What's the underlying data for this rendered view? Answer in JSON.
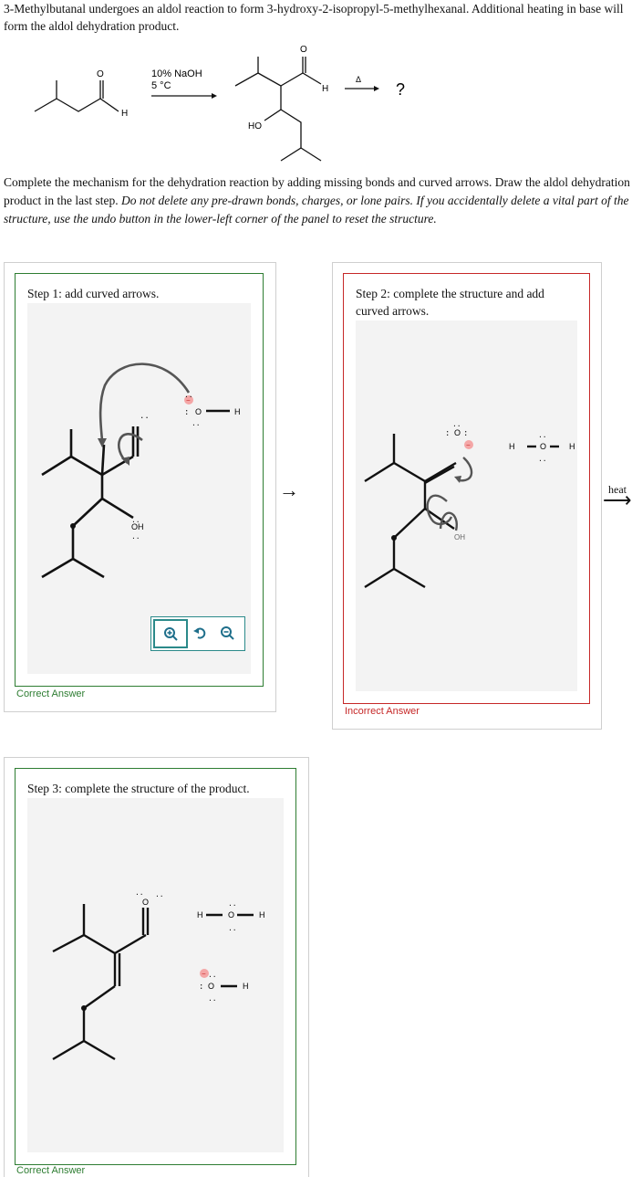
{
  "intro": "3-Methylbutanal undergoes an aldol reaction to form 3-hydroxy-2-isopropyl-5-methylhexanal. Additional heating in base will form the aldol dehydration product.",
  "reaction": {
    "conditions_line1": "10% NaOH",
    "conditions_line2": "5 °C",
    "heat_symbol": "Δ",
    "unknown_product": "?",
    "labels": {
      "h_aldehyde": "H",
      "ho": "HO",
      "o": "O",
      "h": "H"
    }
  },
  "instructions": {
    "normal": "Complete the mechanism for the dehydration reaction by adding missing bonds and curved arrows. Draw the aldol dehydration product in the last step.",
    "italic": "Do not delete any pre-drawn bonds, charges, or lone pairs. If you accidentally delete a vital part of the structure, use the undo button in the lower-left corner of the panel to reset the structure."
  },
  "step1": {
    "title": "Step 1: add curved arrows.",
    "status": "Correct Answer",
    "labels": {
      "oh": "OH",
      "o": "O",
      "h": "H",
      "minus": "−",
      "lp": "..",
      "lp_side": ":"
    },
    "toolbar": {
      "zoom_in": "zoom-in",
      "undo": "undo",
      "zoom_out": "zoom-out"
    }
  },
  "step2": {
    "title": "Step 2: complete the structure and add curved arrows.",
    "status": "Incorrect Answer",
    "labels": {
      "o": "O",
      "h": "H",
      "minus": "−",
      "lp": "..",
      "lp_side": ":",
      "oh": "OH"
    }
  },
  "arrow_between": "→",
  "heat": {
    "label": "heat",
    "arrow": "⟶"
  },
  "step3": {
    "title": "Step 3: complete the structure of the product.",
    "status": "Correct Answer",
    "labels": {
      "o": "O",
      "h": "H",
      "minus": "−",
      "lp": "..",
      "lp_side": ":"
    }
  },
  "colors": {
    "correct": "#2e7d32",
    "incorrect": "#c62828",
    "accent": "#2b8a8a",
    "charge": "#f4a6a6"
  }
}
